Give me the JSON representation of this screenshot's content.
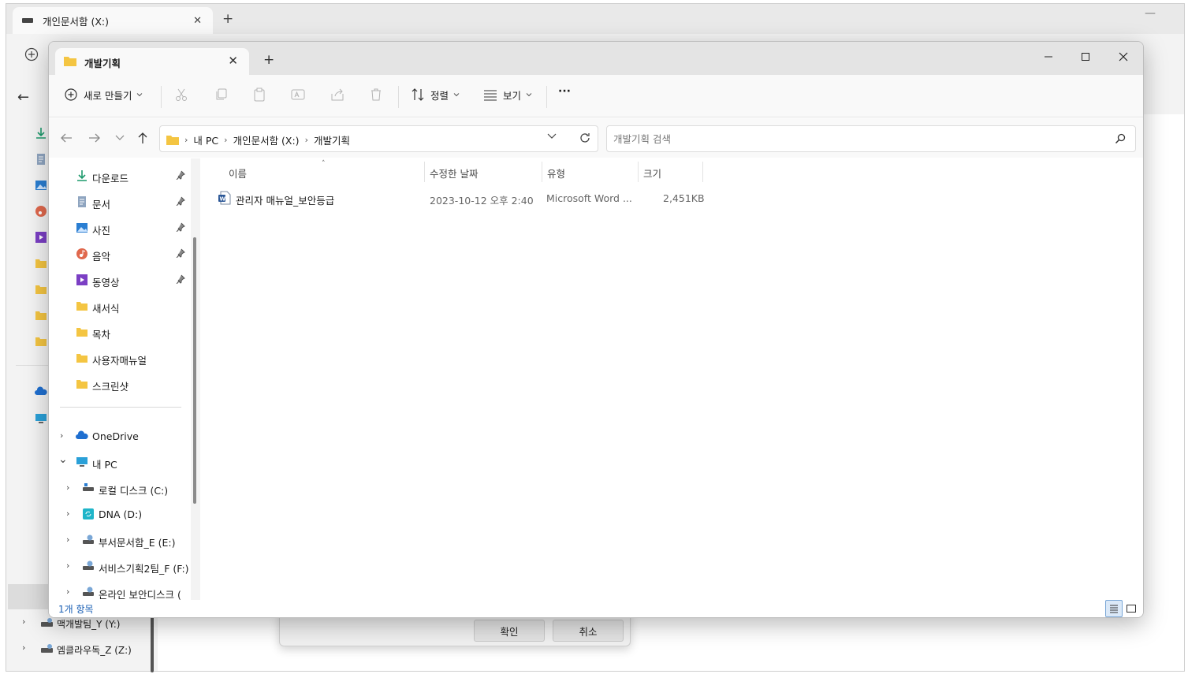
{
  "background_window": {
    "tab_title": "개인문서함 (X:)",
    "tab_close": "✕",
    "new_tab": "+",
    "minimize": "—",
    "back": "←",
    "tree": [
      {
        "label": "맥개발팀_Y (Y:)",
        "chevron": "›"
      },
      {
        "label": "엠클라우독_Z (Z:)",
        "chevron": "›"
      }
    ],
    "dialog": {
      "ok_label": "확인",
      "cancel_label": "취소"
    }
  },
  "window": {
    "tab_title": "개발기획",
    "tab_close": "✕",
    "new_tab": "+"
  },
  "toolbar": {
    "new_label": "새로 만들기",
    "sort_label": "정렬",
    "view_label": "보기",
    "more_label": "···"
  },
  "address": {
    "crumbs": [
      "내 PC",
      "개인문서함 (X:)",
      "개발기획"
    ],
    "separator": "›",
    "search_placeholder": "개발기획 검색"
  },
  "nav": {
    "quick_access": [
      {
        "label": "다운로드",
        "icon": "download-icon",
        "pinned": true
      },
      {
        "label": "문서",
        "icon": "document-icon",
        "pinned": true
      },
      {
        "label": "사진",
        "icon": "picture-icon",
        "pinned": true
      },
      {
        "label": "음악",
        "icon": "music-icon",
        "pinned": true
      },
      {
        "label": "동영상",
        "icon": "video-icon",
        "pinned": true
      },
      {
        "label": "새서식",
        "icon": "folder-icon",
        "pinned": false
      },
      {
        "label": "목차",
        "icon": "folder-icon",
        "pinned": false
      },
      {
        "label": "사용자매뉴얼",
        "icon": "folder-icon",
        "pinned": false
      },
      {
        "label": "스크린샷",
        "icon": "folder-icon",
        "pinned": false
      }
    ],
    "tree": [
      {
        "label": "OneDrive",
        "icon": "cloud-icon",
        "chevron": "›"
      },
      {
        "label": "내 PC",
        "icon": "computer-icon",
        "chevron": "⌄"
      },
      {
        "label": "로컬 디스크 (C:)",
        "icon": "drive-icon",
        "chevron": "›"
      },
      {
        "label": "DNA (D:)",
        "icon": "sync-drive-icon",
        "chevron": "›"
      },
      {
        "label": "부서문서함_E (E:)",
        "icon": "network-drive-icon",
        "chevron": "›"
      },
      {
        "label": "서비스기획2팀_F (F:)",
        "icon": "network-drive-icon",
        "chevron": "›"
      },
      {
        "label": "온라인 보안디스크 (",
        "icon": "network-drive-icon",
        "chevron": "›"
      }
    ]
  },
  "list": {
    "columns": {
      "name": "이름",
      "modified": "수정한 날짜",
      "type": "유형",
      "size": "크기"
    },
    "sort_indicator": "˄",
    "files": [
      {
        "name": "관리자 매뉴얼_보안등급",
        "modified": "2023-10-12 오후 2:40",
        "type": "Microsoft Word ...",
        "size": "2,451KB",
        "icon": "word-document-icon"
      }
    ]
  },
  "status": {
    "item_count": "1개 항목"
  },
  "colors": {
    "accent": "#1a5fb4",
    "folder": "#f4c542",
    "selection": "#dbe9f8"
  }
}
